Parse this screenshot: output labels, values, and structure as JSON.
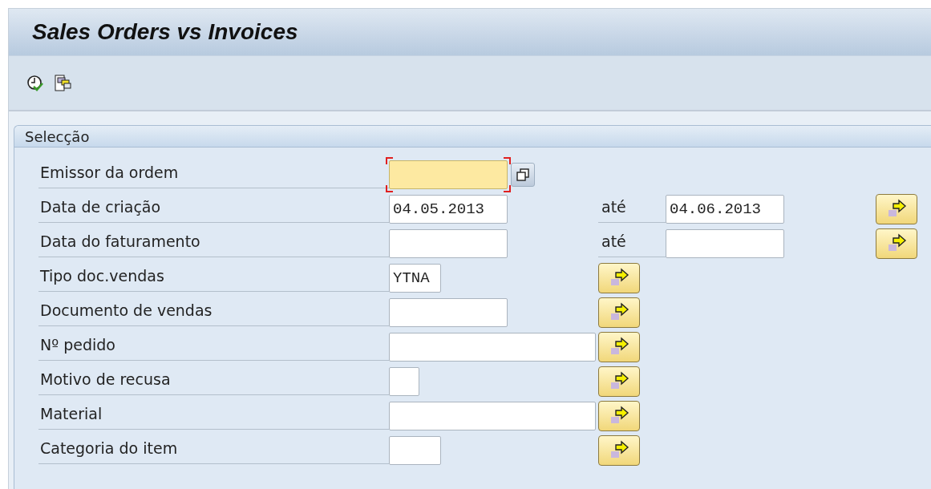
{
  "window": {
    "title": "Sales Orders vs Invoices"
  },
  "toolbar": {
    "buttons": [
      {
        "kind": "execute"
      },
      {
        "kind": "copy"
      }
    ]
  },
  "group": {
    "title": "Selecção",
    "rows": [
      {
        "kind": "single",
        "label": "Emissor da ordem",
        "focused": true,
        "value_help": true,
        "multiple": false
      },
      {
        "kind": "range",
        "label": "Data de criação",
        "value": "04.05.2013",
        "focused": false,
        "value_help": false,
        "multiple": true,
        "to": {
          "label": "até",
          "value": "04.06.2013"
        }
      },
      {
        "kind": "range",
        "label": "Data do faturamento",
        "focused": false,
        "value_help": false,
        "multiple": true,
        "to": {
          "label": "até"
        }
      },
      {
        "kind": "single",
        "label": "Tipo doc.vendas",
        "value": "YTNA",
        "focused": false,
        "value_help": false,
        "multiple": true
      },
      {
        "kind": "single",
        "label": "Documento de vendas",
        "focused": false,
        "value_help": false,
        "multiple": true
      },
      {
        "kind": "single",
        "label": "Nº pedido",
        "focused": false,
        "value_help": false,
        "multiple": true
      },
      {
        "kind": "single",
        "label": "Motivo de recusa",
        "focused": false,
        "value_help": false,
        "multiple": true
      },
      {
        "kind": "single",
        "label": "Material",
        "focused": false,
        "value_help": false,
        "multiple": true
      },
      {
        "kind": "single",
        "label": "Categoria do item",
        "focused": false,
        "value_help": false,
        "multiple": true
      }
    ]
  }
}
